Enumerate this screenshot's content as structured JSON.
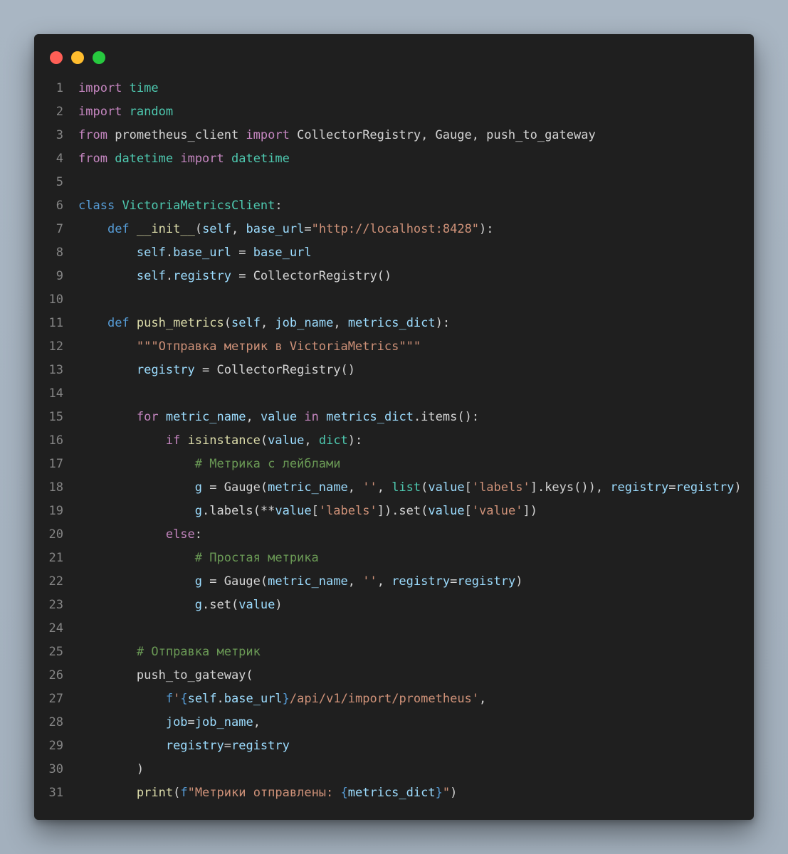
{
  "window": {
    "controls": [
      "close",
      "minimize",
      "maximize"
    ]
  },
  "code": {
    "language": "python",
    "lines": [
      {
        "n": "1",
        "tokens": [
          {
            "t": "import",
            "c": "kw"
          },
          {
            "t": " ",
            "c": "plain"
          },
          {
            "t": "time",
            "c": "mod"
          }
        ]
      },
      {
        "n": "2",
        "tokens": [
          {
            "t": "import",
            "c": "kw"
          },
          {
            "t": " ",
            "c": "plain"
          },
          {
            "t": "random",
            "c": "mod"
          }
        ]
      },
      {
        "n": "3",
        "tokens": [
          {
            "t": "from",
            "c": "kw"
          },
          {
            "t": " prometheus_client ",
            "c": "plain"
          },
          {
            "t": "import",
            "c": "kw"
          },
          {
            "t": " CollectorRegistry, Gauge, push_to_gateway",
            "c": "plain"
          }
        ]
      },
      {
        "n": "4",
        "tokens": [
          {
            "t": "from",
            "c": "kw"
          },
          {
            "t": " ",
            "c": "plain"
          },
          {
            "t": "datetime",
            "c": "mod"
          },
          {
            "t": " ",
            "c": "plain"
          },
          {
            "t": "import",
            "c": "kw"
          },
          {
            "t": " ",
            "c": "plain"
          },
          {
            "t": "datetime",
            "c": "mod"
          }
        ]
      },
      {
        "n": "5",
        "tokens": []
      },
      {
        "n": "6",
        "tokens": [
          {
            "t": "class",
            "c": "dkw"
          },
          {
            "t": " ",
            "c": "plain"
          },
          {
            "t": "VictoriaMetricsClient",
            "c": "mod"
          },
          {
            "t": ":",
            "c": "plain"
          }
        ]
      },
      {
        "n": "7",
        "tokens": [
          {
            "t": "    ",
            "c": "plain"
          },
          {
            "t": "def",
            "c": "dkw"
          },
          {
            "t": " ",
            "c": "plain"
          },
          {
            "t": "__init__",
            "c": "fn"
          },
          {
            "t": "(",
            "c": "plain"
          },
          {
            "t": "self",
            "c": "var"
          },
          {
            "t": ", ",
            "c": "plain"
          },
          {
            "t": "base_url",
            "c": "var"
          },
          {
            "t": "=",
            "c": "plain"
          },
          {
            "t": "\"http://localhost:8428\"",
            "c": "str"
          },
          {
            "t": "):",
            "c": "plain"
          }
        ]
      },
      {
        "n": "8",
        "tokens": [
          {
            "t": "        ",
            "c": "plain"
          },
          {
            "t": "self",
            "c": "var"
          },
          {
            "t": ".",
            "c": "plain"
          },
          {
            "t": "base_url",
            "c": "var"
          },
          {
            "t": " = ",
            "c": "plain"
          },
          {
            "t": "base_url",
            "c": "var"
          }
        ]
      },
      {
        "n": "9",
        "tokens": [
          {
            "t": "        ",
            "c": "plain"
          },
          {
            "t": "self",
            "c": "var"
          },
          {
            "t": ".",
            "c": "plain"
          },
          {
            "t": "registry",
            "c": "var"
          },
          {
            "t": " = CollectorRegistry()",
            "c": "plain"
          }
        ]
      },
      {
        "n": "10",
        "tokens": []
      },
      {
        "n": "11",
        "tokens": [
          {
            "t": "    ",
            "c": "plain"
          },
          {
            "t": "def",
            "c": "dkw"
          },
          {
            "t": " ",
            "c": "plain"
          },
          {
            "t": "push_metrics",
            "c": "fn"
          },
          {
            "t": "(",
            "c": "plain"
          },
          {
            "t": "self",
            "c": "var"
          },
          {
            "t": ", ",
            "c": "plain"
          },
          {
            "t": "job_name",
            "c": "var"
          },
          {
            "t": ", ",
            "c": "plain"
          },
          {
            "t": "metrics_dict",
            "c": "var"
          },
          {
            "t": "):",
            "c": "plain"
          }
        ]
      },
      {
        "n": "12",
        "tokens": [
          {
            "t": "        ",
            "c": "plain"
          },
          {
            "t": "\"\"\"Отправка метрик в VictoriaMetrics\"\"\"",
            "c": "str"
          }
        ]
      },
      {
        "n": "13",
        "tokens": [
          {
            "t": "        ",
            "c": "plain"
          },
          {
            "t": "registry",
            "c": "var"
          },
          {
            "t": " = CollectorRegistry()",
            "c": "plain"
          }
        ]
      },
      {
        "n": "14",
        "tokens": []
      },
      {
        "n": "15",
        "tokens": [
          {
            "t": "        ",
            "c": "plain"
          },
          {
            "t": "for",
            "c": "kw"
          },
          {
            "t": " ",
            "c": "plain"
          },
          {
            "t": "metric_name",
            "c": "var"
          },
          {
            "t": ", ",
            "c": "plain"
          },
          {
            "t": "value",
            "c": "var"
          },
          {
            "t": " ",
            "c": "plain"
          },
          {
            "t": "in",
            "c": "kw"
          },
          {
            "t": " ",
            "c": "plain"
          },
          {
            "t": "metrics_dict",
            "c": "var"
          },
          {
            "t": ".items():",
            "c": "plain"
          }
        ]
      },
      {
        "n": "16",
        "tokens": [
          {
            "t": "            ",
            "c": "plain"
          },
          {
            "t": "if",
            "c": "kw"
          },
          {
            "t": " ",
            "c": "plain"
          },
          {
            "t": "isinstance",
            "c": "fn"
          },
          {
            "t": "(",
            "c": "plain"
          },
          {
            "t": "value",
            "c": "var"
          },
          {
            "t": ", ",
            "c": "plain"
          },
          {
            "t": "dict",
            "c": "mod"
          },
          {
            "t": "):",
            "c": "plain"
          }
        ]
      },
      {
        "n": "17",
        "tokens": [
          {
            "t": "                ",
            "c": "plain"
          },
          {
            "t": "# Метрика с лейблами",
            "c": "com"
          }
        ]
      },
      {
        "n": "18",
        "tokens": [
          {
            "t": "                ",
            "c": "plain"
          },
          {
            "t": "g",
            "c": "var"
          },
          {
            "t": " = Gauge(",
            "c": "plain"
          },
          {
            "t": "metric_name",
            "c": "var"
          },
          {
            "t": ", ",
            "c": "plain"
          },
          {
            "t": "''",
            "c": "str"
          },
          {
            "t": ", ",
            "c": "plain"
          },
          {
            "t": "list",
            "c": "mod"
          },
          {
            "t": "(",
            "c": "plain"
          },
          {
            "t": "value",
            "c": "var"
          },
          {
            "t": "[",
            "c": "plain"
          },
          {
            "t": "'labels'",
            "c": "str"
          },
          {
            "t": "].keys()), ",
            "c": "plain"
          },
          {
            "t": "registry",
            "c": "var"
          },
          {
            "t": "=",
            "c": "plain"
          },
          {
            "t": "registry",
            "c": "var"
          },
          {
            "t": ")",
            "c": "plain"
          }
        ]
      },
      {
        "n": "19",
        "tokens": [
          {
            "t": "                ",
            "c": "plain"
          },
          {
            "t": "g",
            "c": "var"
          },
          {
            "t": ".labels(**",
            "c": "plain"
          },
          {
            "t": "value",
            "c": "var"
          },
          {
            "t": "[",
            "c": "plain"
          },
          {
            "t": "'labels'",
            "c": "str"
          },
          {
            "t": "]).set(",
            "c": "plain"
          },
          {
            "t": "value",
            "c": "var"
          },
          {
            "t": "[",
            "c": "plain"
          },
          {
            "t": "'value'",
            "c": "str"
          },
          {
            "t": "])",
            "c": "plain"
          }
        ]
      },
      {
        "n": "20",
        "tokens": [
          {
            "t": "            ",
            "c": "plain"
          },
          {
            "t": "else",
            "c": "kw"
          },
          {
            "t": ":",
            "c": "plain"
          }
        ]
      },
      {
        "n": "21",
        "tokens": [
          {
            "t": "                ",
            "c": "plain"
          },
          {
            "t": "# Простая метрика",
            "c": "com"
          }
        ]
      },
      {
        "n": "22",
        "tokens": [
          {
            "t": "                ",
            "c": "plain"
          },
          {
            "t": "g",
            "c": "var"
          },
          {
            "t": " = Gauge(",
            "c": "plain"
          },
          {
            "t": "metric_name",
            "c": "var"
          },
          {
            "t": ", ",
            "c": "plain"
          },
          {
            "t": "''",
            "c": "str"
          },
          {
            "t": ", ",
            "c": "plain"
          },
          {
            "t": "registry",
            "c": "var"
          },
          {
            "t": "=",
            "c": "plain"
          },
          {
            "t": "registry",
            "c": "var"
          },
          {
            "t": ")",
            "c": "plain"
          }
        ]
      },
      {
        "n": "23",
        "tokens": [
          {
            "t": "                ",
            "c": "plain"
          },
          {
            "t": "g",
            "c": "var"
          },
          {
            "t": ".set(",
            "c": "plain"
          },
          {
            "t": "value",
            "c": "var"
          },
          {
            "t": ")",
            "c": "plain"
          }
        ]
      },
      {
        "n": "24",
        "tokens": []
      },
      {
        "n": "25",
        "tokens": [
          {
            "t": "        ",
            "c": "plain"
          },
          {
            "t": "# Отправка метрик",
            "c": "com"
          }
        ]
      },
      {
        "n": "26",
        "tokens": [
          {
            "t": "        ",
            "c": "plain"
          },
          {
            "t": "push_to_gateway(",
            "c": "plain"
          }
        ]
      },
      {
        "n": "27",
        "tokens": [
          {
            "t": "            ",
            "c": "plain"
          },
          {
            "t": "f",
            "c": "dkw"
          },
          {
            "t": "'",
            "c": "str"
          },
          {
            "t": "{",
            "c": "dkw"
          },
          {
            "t": "self",
            "c": "var"
          },
          {
            "t": ".",
            "c": "plain"
          },
          {
            "t": "base_url",
            "c": "var"
          },
          {
            "t": "}",
            "c": "dkw"
          },
          {
            "t": "/api/v1/import/prometheus'",
            "c": "str"
          },
          {
            "t": ",",
            "c": "plain"
          }
        ]
      },
      {
        "n": "28",
        "tokens": [
          {
            "t": "            ",
            "c": "plain"
          },
          {
            "t": "job",
            "c": "var"
          },
          {
            "t": "=",
            "c": "plain"
          },
          {
            "t": "job_name",
            "c": "var"
          },
          {
            "t": ",",
            "c": "plain"
          }
        ]
      },
      {
        "n": "29",
        "tokens": [
          {
            "t": "            ",
            "c": "plain"
          },
          {
            "t": "registry",
            "c": "var"
          },
          {
            "t": "=",
            "c": "plain"
          },
          {
            "t": "registry",
            "c": "var"
          }
        ]
      },
      {
        "n": "30",
        "tokens": [
          {
            "t": "        )",
            "c": "plain"
          }
        ]
      },
      {
        "n": "31",
        "tokens": [
          {
            "t": "        ",
            "c": "plain"
          },
          {
            "t": "print",
            "c": "fn"
          },
          {
            "t": "(",
            "c": "plain"
          },
          {
            "t": "f",
            "c": "dkw"
          },
          {
            "t": "\"Метрики отправлены: ",
            "c": "str"
          },
          {
            "t": "{",
            "c": "dkw"
          },
          {
            "t": "metrics_dict",
            "c": "var"
          },
          {
            "t": "}",
            "c": "dkw"
          },
          {
            "t": "\"",
            "c": "str"
          },
          {
            "t": ")",
            "c": "plain"
          }
        ]
      }
    ]
  },
  "colors": {
    "background": "#a9b6c3",
    "editor_bg": "#1f1f1f",
    "keyword": "#c586c0",
    "declaration": "#569cd6",
    "type_module": "#4ec9b0",
    "function": "#dcdcaa",
    "variable": "#9cdcfe",
    "string": "#ce9178",
    "comment": "#6a9955",
    "line_number": "#858585",
    "close_dot": "#ff5f56",
    "minimize_dot": "#ffbd2e",
    "maximize_dot": "#27c93f"
  }
}
